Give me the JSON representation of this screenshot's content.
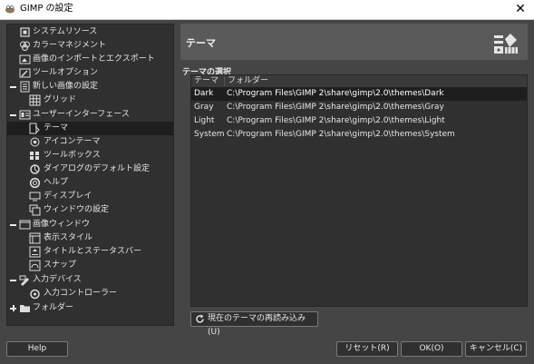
{
  "window": {
    "title": "GIMP の設定",
    "close_glyph": "✕"
  },
  "tree": {
    "items": [
      {
        "label": "システムリソース",
        "icon": "system-resources-icon"
      },
      {
        "label": "カラーマネジメント",
        "icon": "color-management-icon"
      },
      {
        "label": "画像のインポートとエクスポート",
        "icon": "import-export-icon"
      },
      {
        "label": "ツールオプション",
        "icon": "tool-options-icon"
      },
      {
        "label": "新しい画像の設定",
        "icon": "new-image-icon",
        "expander": "minus"
      },
      {
        "label": "グリッド",
        "icon": "grid-icon"
      },
      {
        "label": "ユーザーインターフェース",
        "icon": "user-interface-icon",
        "expander": "minus"
      },
      {
        "label": "テーマ",
        "icon": "theme-icon",
        "selected": true
      },
      {
        "label": "アイコンテーマ",
        "icon": "icon-theme-icon"
      },
      {
        "label": "ツールボックス",
        "icon": "toolbox-icon"
      },
      {
        "label": "ダイアログのデフォルト設定",
        "icon": "dialog-defaults-icon"
      },
      {
        "label": "ヘルプ",
        "icon": "help-icon"
      },
      {
        "label": "ディスプレイ",
        "icon": "display-icon"
      },
      {
        "label": "ウィンドウの設定",
        "icon": "window-management-icon"
      },
      {
        "label": "画像ウィンドウ",
        "icon": "image-window-icon",
        "expander": "minus"
      },
      {
        "label": "表示スタイル",
        "icon": "appearance-icon"
      },
      {
        "label": "タイトルとステータスバー",
        "icon": "title-statusbar-icon"
      },
      {
        "label": "スナップ",
        "icon": "snapping-icon"
      },
      {
        "label": "入力デバイス",
        "icon": "input-devices-icon",
        "expander": "minus"
      },
      {
        "label": "入力コントローラー",
        "icon": "input-controllers-icon"
      },
      {
        "label": "フォルダー",
        "icon": "folders-icon",
        "expander": "plus"
      }
    ]
  },
  "header": {
    "title": "テーマ",
    "icon": "theme-palette-icon"
  },
  "theme_select": {
    "label": "テーマの選択",
    "columns": [
      "テーマ",
      "フォルダー"
    ],
    "rows": [
      {
        "name": "Dark",
        "folder": "C:\\Program Files\\GIMP 2\\share\\gimp\\2.0\\themes\\Dark",
        "selected": true
      },
      {
        "name": "Gray",
        "folder": "C:\\Program Files\\GIMP 2\\share\\gimp\\2.0\\themes\\Gray"
      },
      {
        "name": "Light",
        "folder": "C:\\Program Files\\GIMP 2\\share\\gimp\\2.0\\themes\\Light"
      },
      {
        "name": "System",
        "folder": "C:\\Program Files\\GIMP 2\\share\\gimp\\2.0\\themes\\System"
      }
    ]
  },
  "buttons": {
    "reload": "現在のテーマの再読み込み(U)",
    "help": "Help",
    "reset": "リセット(R)",
    "ok": "OK(O)",
    "cancel": "キャンセル(C)"
  }
}
